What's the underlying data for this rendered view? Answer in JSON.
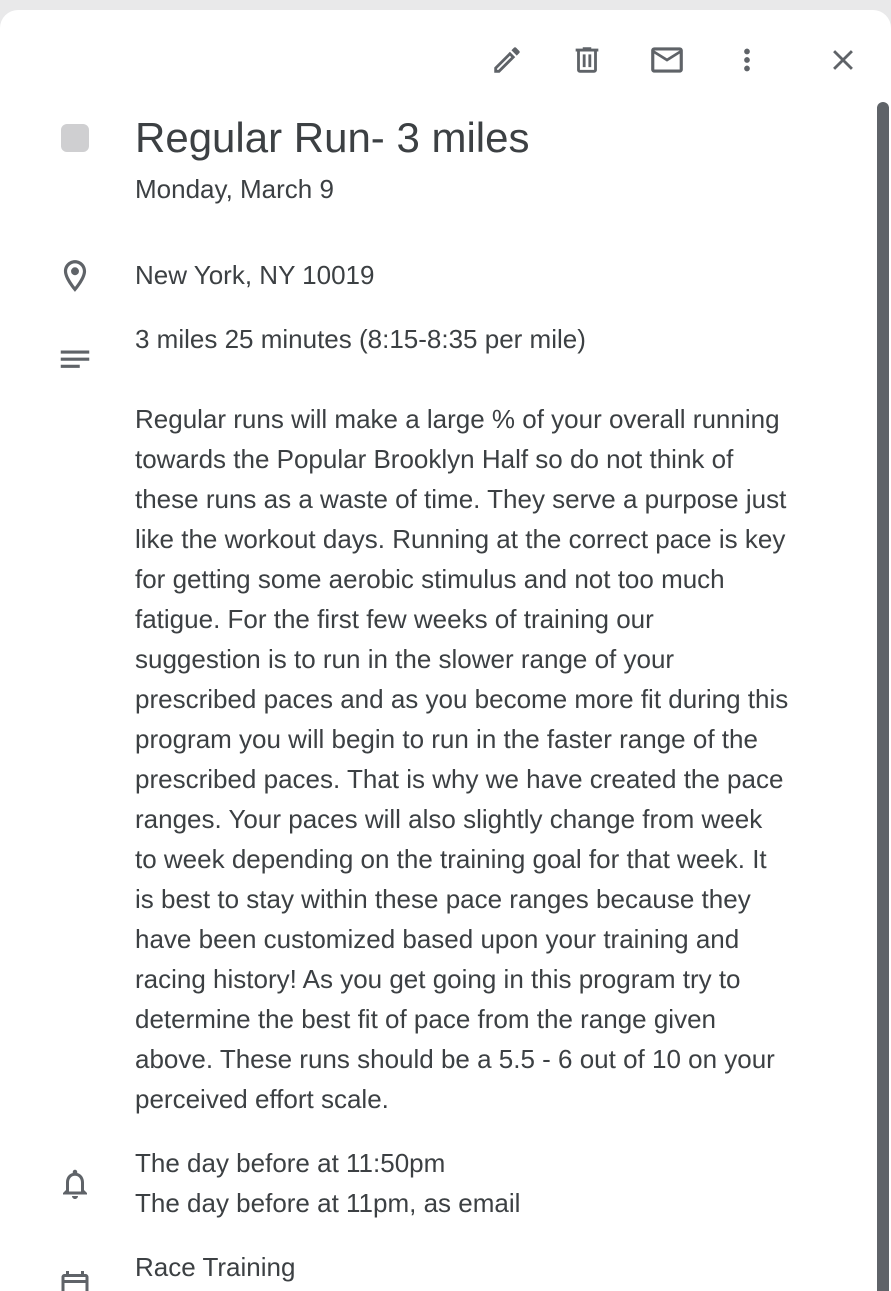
{
  "toolbar": {
    "icons": [
      "edit-icon",
      "delete-icon",
      "email-icon",
      "more-vert-icon",
      "close-icon"
    ]
  },
  "event": {
    "color": "#cfcfd1",
    "title": "Regular Run- 3 miles",
    "date": "Monday, March 9",
    "location": "New York, NY 10019",
    "summary": "3 miles 25 minutes (8:15-8:35 per mile)",
    "description_lines": [
      "Regular runs will make a large % of your overall running",
      "towards the Popular Brooklyn Half so do not think of",
      "these runs as a waste of time. They serve a purpose just",
      "like the workout days. Running at the correct pace is key",
      "for getting some aerobic stimulus and not too much",
      "fatigue. For the first few weeks of training our",
      "suggestion is to run in the slower range of your",
      "prescribed paces and as you become more fit during this",
      "program you will begin to run in the faster range of the",
      "prescribed paces. That is why we have created the pace",
      "ranges. Your paces will also slightly change from week",
      "to week depending on the training goal for that week.  It",
      "is best to stay within these pace ranges because they",
      "have been customized based upon your training and",
      "racing history! As you get going in this program try to",
      "determine the best fit of pace from the range given",
      "above. These runs should be a 5.5 - 6 out of 10 on your",
      "perceived effort scale."
    ],
    "reminders": [
      "The day before at 11:50pm",
      "The day before at 11pm, as email"
    ],
    "calendar": "Race Training"
  }
}
